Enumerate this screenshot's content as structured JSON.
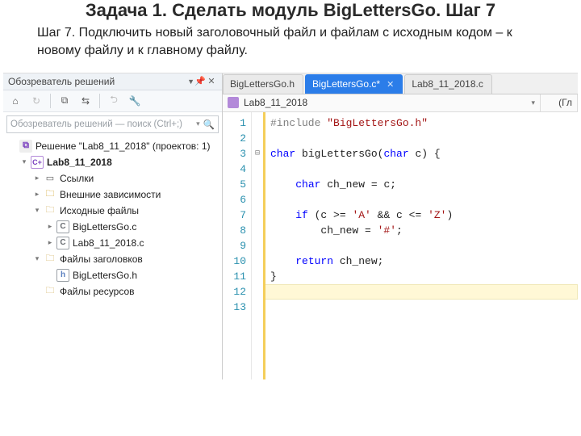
{
  "slide": {
    "title": "Задача 1. Сделать модуль BigLettersGo. Шаг 7",
    "body": "Шаг 7. Подключить новый заголовочный файл и файлам с исходным кодом – к новому файлу и к главному файлу."
  },
  "solution_explorer": {
    "title": "Обозреватель решений",
    "search_placeholder": "Обозреватель решений — поиск (Ctrl+;)",
    "toolbar_icons": [
      "home",
      "refresh-cycle",
      "package",
      "sync",
      "back",
      "wrench"
    ],
    "tree": {
      "solution_label": "Решение \"Lab8_11_2018\" (проектов: 1)",
      "project_label": "Lab8_11_2018",
      "nodes": [
        {
          "label": "Ссылки",
          "kind": "ref"
        },
        {
          "label": "Внешние зависимости",
          "kind": "dep"
        },
        {
          "label": "Исходные файлы",
          "kind": "folder",
          "expanded": true,
          "children": [
            {
              "label": "BigLettersGo.c",
              "kind": "cfile"
            },
            {
              "label": "Lab8_11_2018.c",
              "kind": "cfile"
            }
          ]
        },
        {
          "label": "Файлы заголовков",
          "kind": "folder",
          "expanded": true,
          "children": [
            {
              "label": "BigLettersGo.h",
              "kind": "hfile"
            }
          ]
        },
        {
          "label": "Файлы ресурсов",
          "kind": "folder",
          "expanded": false
        }
      ]
    }
  },
  "editor": {
    "tabs": [
      {
        "label": "BigLettersGo.h",
        "active": false
      },
      {
        "label": "BigLettersGo.c*",
        "active": true,
        "closable": true
      },
      {
        "label": "Lab8_11_2018.c",
        "active": false
      }
    ],
    "navbar": {
      "project": "Lab8_11_2018",
      "scope_hint": "(Гл"
    },
    "lines": [
      {
        "n": 1,
        "html": "<span class='pp'>#include </span><span class='str'>\"BigLettersGo.h\"</span>"
      },
      {
        "n": 2,
        "html": ""
      },
      {
        "n": 3,
        "html": "<span class='typ'>char</span> bigLettersGo(<span class='typ'>char</span> c) {",
        "fold": "open"
      },
      {
        "n": 4,
        "html": ""
      },
      {
        "n": 5,
        "html": "    <span class='typ'>char</span> ch_new = c;"
      },
      {
        "n": 6,
        "html": ""
      },
      {
        "n": 7,
        "html": "    <span class='kw'>if</span> (c &gt;= <span class='chr'>'A'</span> &amp;&amp; c &lt;= <span class='chr'>'Z'</span>)"
      },
      {
        "n": 8,
        "html": "        ch_new = <span class='chr'>'#'</span>;"
      },
      {
        "n": 9,
        "html": ""
      },
      {
        "n": 10,
        "html": "    <span class='kw'>return</span> ch_new;"
      },
      {
        "n": 11,
        "html": "}"
      },
      {
        "n": 12,
        "html": "",
        "caret": true
      },
      {
        "n": 13,
        "html": ""
      }
    ]
  }
}
